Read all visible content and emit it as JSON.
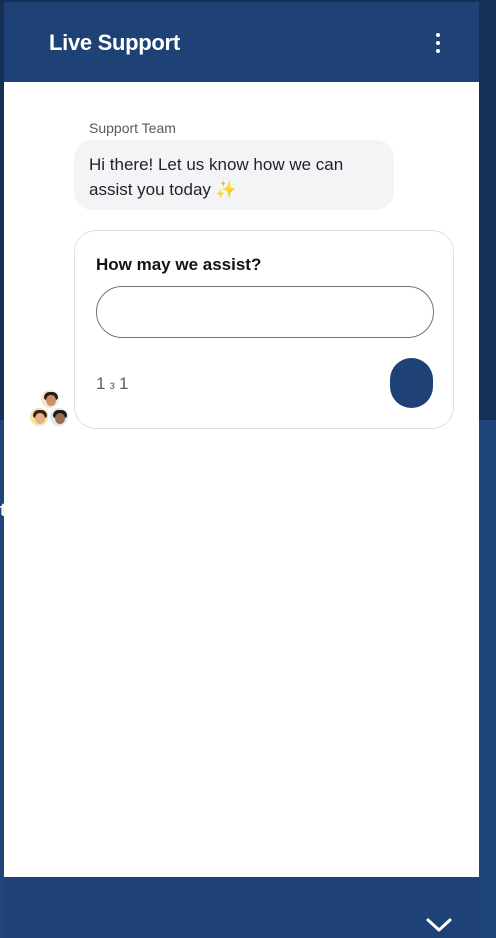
{
  "widget": {
    "title": "Live Support",
    "menu_icon": "more-vertical-icon",
    "collapse_icon": "chevron-down-icon"
  },
  "conversation": {
    "sender": "Support Team",
    "message": "Hi there! Let us know how we can assist you today ✨"
  },
  "form": {
    "question": "How may we assist?",
    "input_value": "",
    "step_current": "1",
    "step_separator": "з",
    "step_total": "1"
  },
  "colors": {
    "brand": "#1e4276",
    "bubble": "#f3f4f6",
    "card_border": "#dcdfe4"
  }
}
